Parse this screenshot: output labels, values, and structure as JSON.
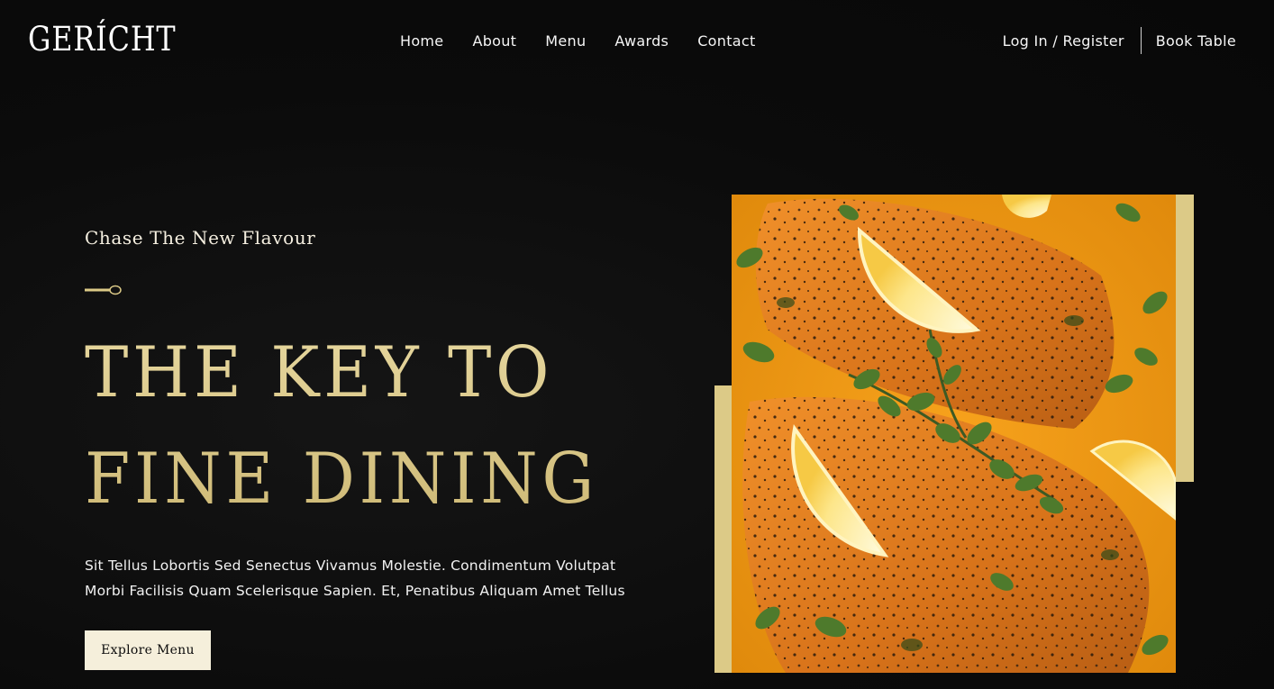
{
  "brand": {
    "logo": "GERÍCHT"
  },
  "nav": {
    "links": [
      "Home",
      "About",
      "Menu",
      "Awards",
      "Contact"
    ],
    "login": "Log In / Register",
    "book": "Book Table"
  },
  "hero": {
    "subtitle": "Chase The New Flavour",
    "headline_line1": "THE KEY TO",
    "headline_line2": "FINE DINING",
    "description_line1": "Sit Tellus Lobortis Sed Senectus Vivamus Molestie. Condimentum Volutpat",
    "description_line2": "Morbi Facilisis Quam Scelerisque Sapien. Et, Penatibus Aliquam Amet Tellus",
    "cta": "Explore Menu",
    "divider_icon": "spoon-icon",
    "image_alt": "salmon-lemon-oregano-dish"
  },
  "colors": {
    "accent": "#DCCA87",
    "background": "#0C0C0C",
    "button_bg": "#F5EFDB",
    "text": "#FFFFFF"
  }
}
